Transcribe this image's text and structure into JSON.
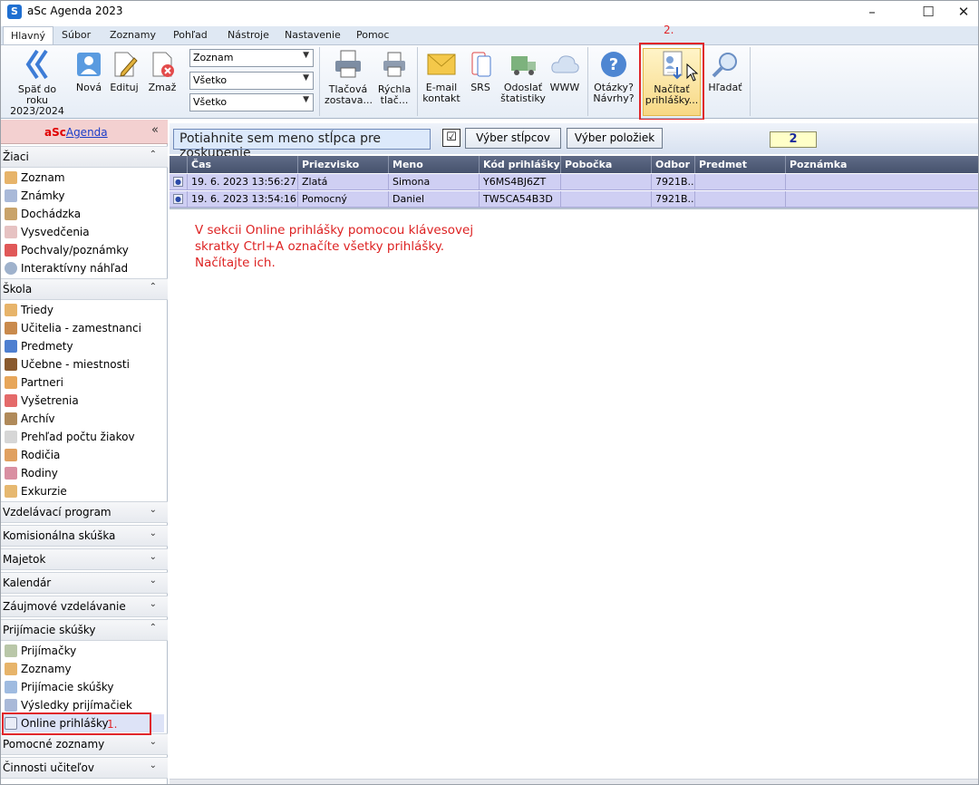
{
  "window": {
    "title": "aSc Agenda 2023",
    "controls": {
      "minimize": "–",
      "maximize": "☐",
      "close": "✕"
    }
  },
  "menu_tabs": [
    "Hlavný",
    "Súbor",
    "Zoznamy",
    "Pohľad",
    "Nástroje",
    "Nastavenie",
    "Pomoc"
  ],
  "ribbon": {
    "back_label_1": "Späť do roku",
    "back_label_2": "2023/2024",
    "new_label": "Nová",
    "edit_label": "Edituj",
    "delete_label": "Zmaž",
    "combo_1": "Zoznam",
    "combo_2": "Všetko",
    "combo_3": "Všetko",
    "print_label_1": "Tlačová",
    "print_label_2": "zostava...",
    "quickprint_label_1": "Rýchla",
    "quickprint_label_2": "tlač...",
    "email_label_1": "E-mail",
    "email_label_2": "kontakt",
    "srs_label": "SRS",
    "stats_label_1": "Odoslať",
    "stats_label_2": "štatistiky",
    "www_label": "WWW",
    "help_label_1": "Otázky?",
    "help_label_2": "Návrhy?",
    "load_label_1": "Načítať",
    "load_label_2": "prihlášky...",
    "search_label": "Hľadať"
  },
  "annotations": {
    "step1": "1.",
    "step2": "2."
  },
  "sidebar": {
    "brand_prefix": "aSc",
    "brand_suffix": "Agenda",
    "collapse": "«",
    "sections": {
      "ziaci": "Žiaci",
      "skola": "Škola",
      "vzdelavaci": "Vzdelávací program",
      "komisionalna": "Komisionálna skúška",
      "majetok": "Majetok",
      "kalendar": "Kalendár",
      "zaujmove": "Záujmové vzdelávanie",
      "prijimacie": "Prijímacie skúšky",
      "pomocne": "Pomocné zoznamy",
      "cinnosti": "Činnosti učiteľov"
    },
    "ziaci_items": [
      "Zoznam",
      "Známky",
      "Dochádzka",
      "Vysvedčenia",
      "Pochvaly/poznámky",
      "Interaktívny náhľad"
    ],
    "skola_items": [
      "Triedy",
      "Učitelia - zamestnanci",
      "Predmety",
      "Učebne - miestnosti",
      "Partneri",
      "Vyšetrenia",
      "Archív",
      "Prehľad počtu žiakov",
      "Rodičia",
      "Rodiny",
      "Exkurzie"
    ],
    "prijimacie_items": [
      "Prijímačky",
      "Zoznamy",
      "Prijímacie skúšky",
      "Výsledky prijímačiek",
      "Online prihlášky"
    ]
  },
  "main": {
    "group_placeholder": "Potiahnite sem meno stĺpca pre zoskupenie",
    "check_mark": "☑",
    "column_select": "Výber stĺpcov",
    "item_select": "Výber položiek",
    "count": "2",
    "columns": [
      "Čas",
      "Priezvisko",
      "Meno",
      "Kód prihlášky",
      "Pobočka",
      "Odbor",
      "Predmet",
      "Poznámka"
    ],
    "rows": [
      [
        "19. 6. 2023 13:56:27",
        "Zlatá",
        "Simona",
        "Y6MS4BJ6ZT",
        "",
        "7921B...",
        "",
        ""
      ],
      [
        "19. 6. 2023 13:54:16",
        "Pomocný",
        "Daniel",
        "TW5CA54B3D",
        "",
        "7921B...",
        "",
        ""
      ]
    ],
    "note_lines": [
      "V sekcii Online prihlášky pomocou klávesovej",
      "skratky Ctrl+A označíte všetky prihlášky.",
      "Načítajte ich."
    ]
  },
  "colors": {
    "highlight_red": "#e0262a",
    "grid_header": "#4e5a76",
    "row_bg": "#cfcff3",
    "ribbon_bg": "#e6edf6"
  }
}
